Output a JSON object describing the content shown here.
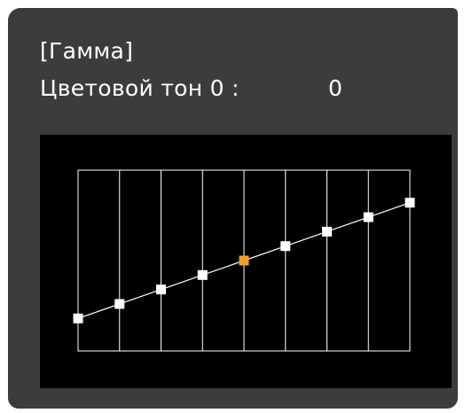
{
  "header": {
    "title": "[Гамма]",
    "tone_label": "Цветовой тон 0 :",
    "tone_value": "0"
  },
  "gamma_graph": {
    "columns": 8,
    "points": [
      0,
      0.125,
      0.25,
      0.375,
      0.5,
      0.625,
      0.75,
      0.875,
      1.0
    ],
    "levels": [
      0.18,
      0.26,
      0.34,
      0.42,
      0.5,
      0.58,
      0.66,
      0.74,
      0.82
    ],
    "selected_index": 4,
    "colors": {
      "grid": "#ffffff",
      "curve": "#ffffff",
      "point": "#ffffff",
      "selected_point": "#f0a030",
      "background": "#000000",
      "panel": "#3c3c3c"
    }
  }
}
